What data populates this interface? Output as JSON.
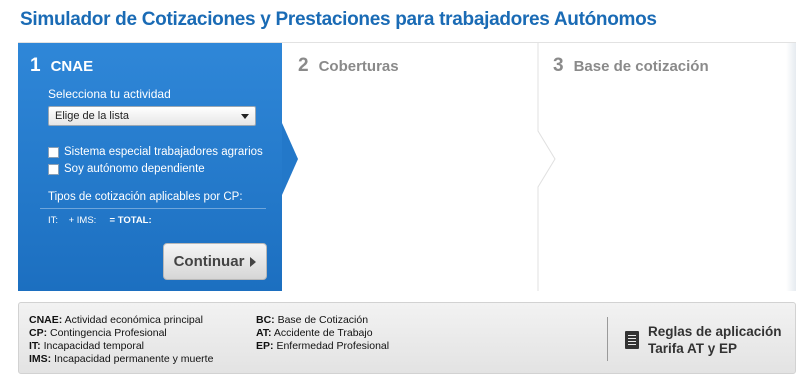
{
  "header": {
    "title": "Simulador de Cotizaciones y Prestaciones para trabajadores Autónomos"
  },
  "steps": [
    {
      "number": "1",
      "label": "CNAE"
    },
    {
      "number": "2",
      "label": "Coberturas"
    },
    {
      "number": "3",
      "label": "Base de cotización"
    }
  ],
  "step1": {
    "subtitle": "Selecciona tu actividad",
    "select_value": "Elige de la lista",
    "checkboxes": [
      {
        "label": "Sistema especial trabajadores agrarios",
        "checked": false
      },
      {
        "label": "Soy autónomo dependiente",
        "checked": false
      }
    ],
    "tipos_label": "Tipos de cotización aplicables por CP:",
    "rates": {
      "it": "IT:",
      "ims": "+ IMS:",
      "total": "= TOTAL:"
    },
    "continue_label": "Continuar"
  },
  "legend": {
    "col1": [
      {
        "abbr": "CNAE:",
        "text": "Actividad económica principal"
      },
      {
        "abbr": "CP:",
        "text": "Contingencia Profesional"
      },
      {
        "abbr": "IT:",
        "text": "Incapacidad temporal"
      },
      {
        "abbr": "IMS:",
        "text": "Incapacidad permanente y muerte"
      }
    ],
    "col2": [
      {
        "abbr": "BC:",
        "text": "Base de Cotización"
      },
      {
        "abbr": "AT:",
        "text": "Accidente de Trabajo"
      },
      {
        "abbr": "EP:",
        "text": "Enfermedad Profesional"
      }
    ],
    "rules_link": {
      "line1": "Reglas de aplicación",
      "line2": "Tarifa AT y EP",
      "icon": "document-icon"
    }
  },
  "colors": {
    "accent": "#1a6bb5",
    "step_active": "#2378c9",
    "inactive_text": "#8a8a8a"
  }
}
